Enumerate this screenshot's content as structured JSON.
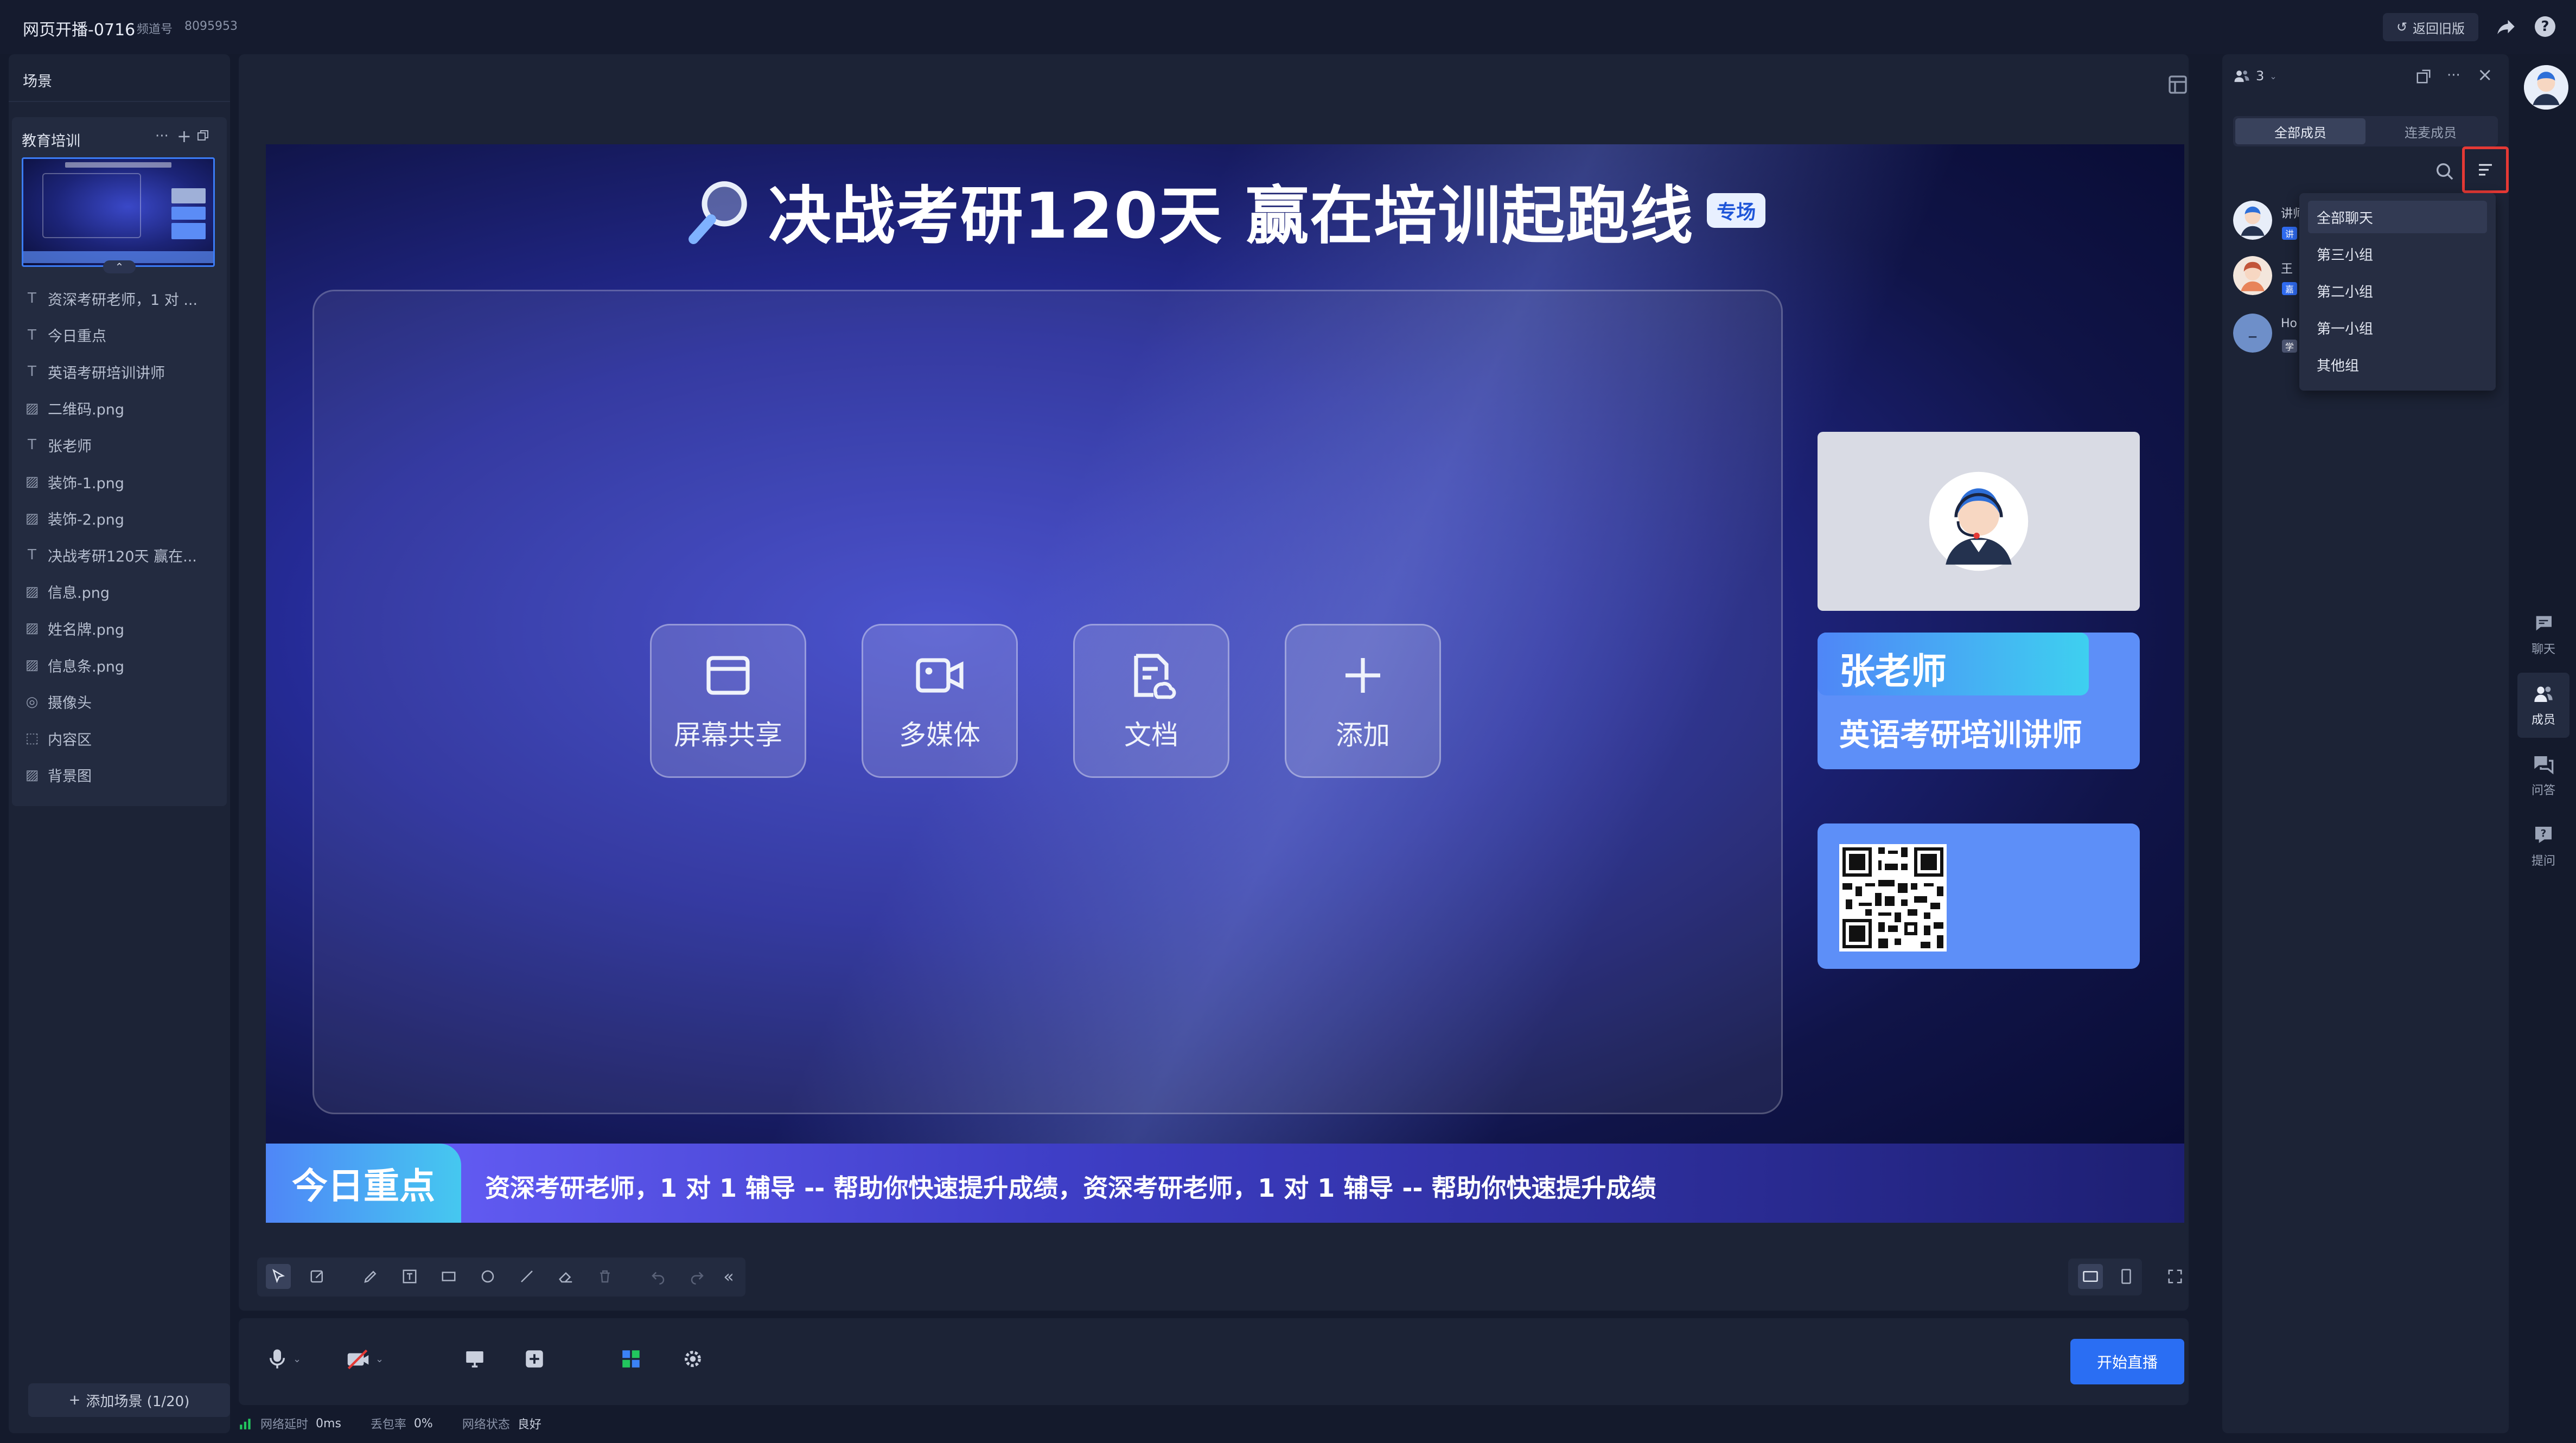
{
  "top_bar": {
    "title": "网页开播-0716",
    "channel_label": "频道号",
    "channel_no": "8095953",
    "back_old": "返回旧版"
  },
  "left_panel": {
    "title": "场景",
    "group_name": "教育培训",
    "layers": [
      {
        "icon": "text-icon",
        "label": "资深考研老师，1 对 ..."
      },
      {
        "icon": "text-icon",
        "label": "今日重点"
      },
      {
        "icon": "text-icon",
        "label": "英语考研培训讲师"
      },
      {
        "icon": "image-icon",
        "label": "二维码.png"
      },
      {
        "icon": "text-icon",
        "label": "张老师"
      },
      {
        "icon": "image-icon",
        "label": "装饰-1.png"
      },
      {
        "icon": "image-icon",
        "label": "装饰-2.png"
      },
      {
        "icon": "text-icon",
        "label": "决战考研120天 赢在..."
      },
      {
        "icon": "image-icon",
        "label": "信息.png"
      },
      {
        "icon": "image-icon",
        "label": "姓名牌.png"
      },
      {
        "icon": "image-icon",
        "label": "信息条.png"
      },
      {
        "icon": "camera-icon",
        "label": "摄像头"
      },
      {
        "icon": "content-area-icon",
        "label": "内容区"
      },
      {
        "icon": "image-icon",
        "label": "背景图"
      }
    ],
    "add_scene": "添加场景 (1/20)"
  },
  "canvas": {
    "headline": "决战考研120天 赢在培训起跑线",
    "headline_tag": "专场",
    "media_buttons": [
      {
        "icon": "screen-share-icon",
        "label": "屏幕共享"
      },
      {
        "icon": "multimedia-icon",
        "label": "多媒体"
      },
      {
        "icon": "document-icon",
        "label": "文档"
      },
      {
        "icon": "add-icon",
        "label": "添加"
      }
    ],
    "teacher_name": "张老师",
    "teacher_role": "英语考研培训讲师",
    "ticker_tag": "今日重点",
    "ticker_text": "资深考研老师，1 对 1 辅导 -- 帮助你快速提升成绩，资深考研老师，1 对 1 辅导 -- 帮助你快速提升成绩"
  },
  "controls": {
    "start_live": "开始直播"
  },
  "status_bar": {
    "latency_label": "网络延时",
    "latency_value": "0ms",
    "loss_label": "丢包率",
    "loss_value": "0%",
    "net_label": "网络状态",
    "net_value": "良好"
  },
  "right_panel": {
    "member_count": "3",
    "tabs": [
      "全部成员",
      "连麦成员"
    ],
    "members": [
      {
        "name": "讲师",
        "role": "讲",
        "avatar_color": "#5b8cf6"
      },
      {
        "name": "王",
        "role": "嘉",
        "avatar_color": "#e8845a"
      },
      {
        "name": "Ho",
        "role": "学",
        "avatar_color": "#6e8fc9"
      }
    ],
    "filter_options": [
      "全部聊天",
      "第三小组",
      "第二小组",
      "第一小组",
      "其他组"
    ]
  },
  "rail": [
    {
      "icon": "chat-icon",
      "label": "聊天"
    },
    {
      "icon": "members-icon",
      "label": "成员"
    },
    {
      "icon": "qa-icon",
      "label": "问答"
    },
    {
      "icon": "question-icon",
      "label": "提问"
    }
  ],
  "colors": {
    "accent": "#2a6ef3",
    "highlight_border": "#e53935",
    "card_blue": "#5d8ff8"
  }
}
